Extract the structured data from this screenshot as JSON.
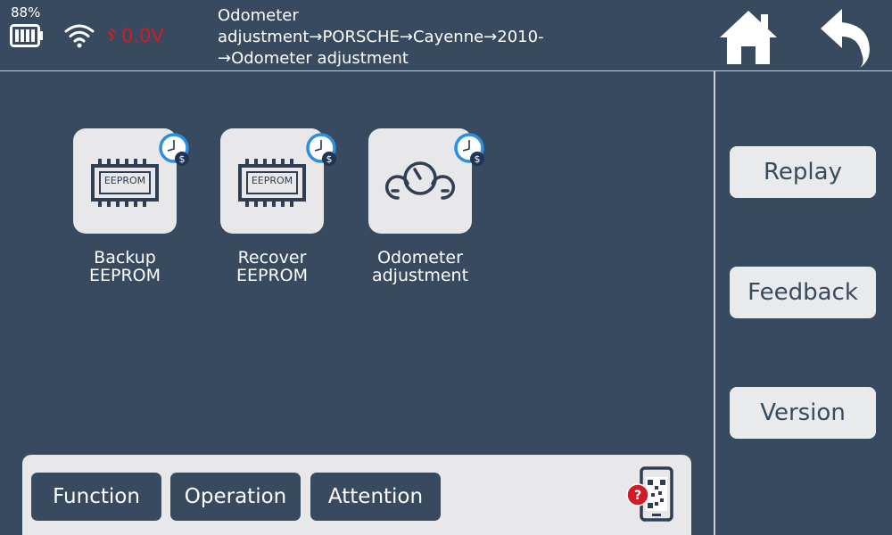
{
  "status": {
    "battery_percent": "88%",
    "voltage": "0.0V"
  },
  "header": {
    "breadcrumb": "Odometer\nadjustment→PORSCHE→Cayenne→2010-\n→Odometer adjustment"
  },
  "tiles": [
    {
      "chip_label": "EEPROM",
      "label": "Backup\nEEPROM"
    },
    {
      "chip_label": "EEPROM",
      "label": "Recover\nEEPROM"
    },
    {
      "label": "Odometer\nadjustment"
    }
  ],
  "sidebar": {
    "replay_label": "Replay",
    "feedback_label": "Feedback",
    "version_label": "Version"
  },
  "bottom_tabs": {
    "function_label": "Function",
    "operation_label": "Operation",
    "attention_label": "Attention"
  },
  "colors": {
    "background": "#384a5f",
    "tile": "#e8e8ea",
    "voltage": "#d01c25",
    "badge_clock": "#2a8fe0",
    "badge_coin": "#1f3552",
    "help_badge": "#d01c25"
  },
  "icons": {
    "battery": "battery-icon",
    "wifi": "wifi-icon",
    "voltage": "plug-icon",
    "home": "home-icon",
    "back": "back-arrow-icon",
    "chip": "chip-icon",
    "odometer": "gauges-icon",
    "badge": "clock-coin-icon",
    "help": "phone-qr-help-icon"
  }
}
